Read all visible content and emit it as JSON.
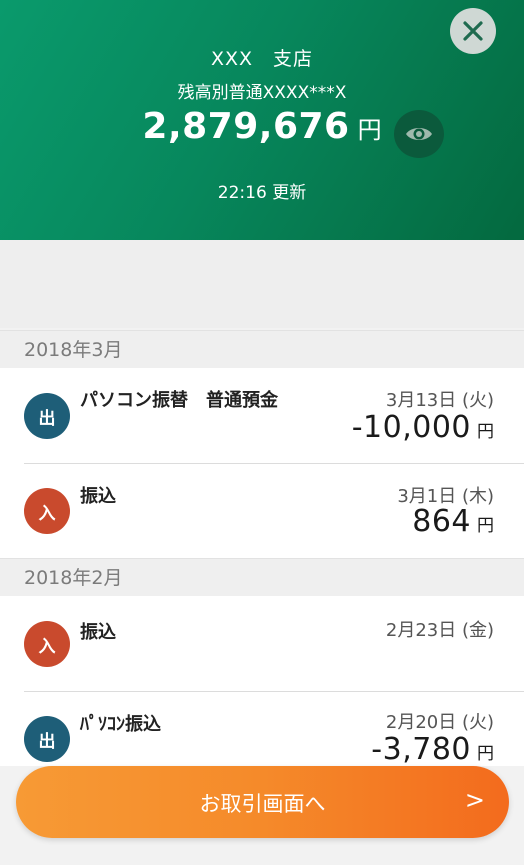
{
  "header": {
    "branch": "XXX　支店",
    "account": "残高別普通XXXX***X",
    "balance": "2,879,676",
    "balance_unit": "円",
    "updated": "22:16 更新"
  },
  "months": [
    {
      "label": "2018年3月",
      "transactions": [
        {
          "type": "出",
          "description": "パソコン振替　普通預金",
          "date": "3月13日 (火)",
          "amount": "-10,000",
          "unit": "円"
        },
        {
          "type": "入",
          "description": "振込",
          "date": "3月1日 (木)",
          "amount": "864",
          "unit": "円"
        }
      ]
    },
    {
      "label": "2018年2月",
      "transactions": [
        {
          "type": "入",
          "description": "振込",
          "date": "2月23日 (金)",
          "amount": "",
          "unit": ""
        },
        {
          "type": "出",
          "description": "ﾊﾟｿｺﾝ振込",
          "date": "2月20日 (火)",
          "amount": "-3,780",
          "unit": "円"
        }
      ]
    }
  ],
  "cta": {
    "label": "お取引画面へ",
    "arrow": ">"
  },
  "colors": {
    "header_green": "#07875c",
    "out_badge": "#1e5e78",
    "in_badge": "#c94a2d",
    "cta_orange": "#f58a2a"
  },
  "icons": {
    "close": "close-icon",
    "eye": "eye-icon"
  }
}
